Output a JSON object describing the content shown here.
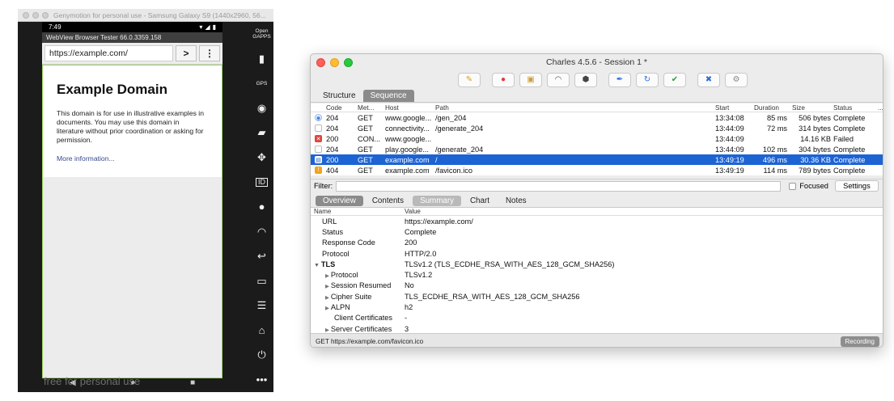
{
  "genymotion": {
    "title": "Genymotion for personal use - Samsung Galaxy S9 (1440x2960, 56...",
    "watermark": "free for personal use",
    "side_icons": [
      "Open GAPPS",
      "battery-icon",
      "GPS",
      "webcam-icon",
      "clapper-icon",
      "move-icon",
      "ID",
      "disk-icon",
      "rss-icon",
      "back-icon",
      "recent-apps-icon",
      "menu-icon",
      "home-icon",
      "power-icon",
      "more-icon"
    ],
    "side_labels": {
      "gapps": "Open GAPPS",
      "gps": "GPS",
      "id": "ID"
    }
  },
  "phone": {
    "time": "7:49",
    "app_title": "WebView Browser Tester 66.0.3359.158",
    "url": "https://example.com/",
    "go_button": ">",
    "menu_button": "⋮",
    "page": {
      "heading": "Example Domain",
      "paragraph": "This domain is for use in illustrative examples in documents. You may use this domain in literature without prior coordination or asking for permission.",
      "link": "More information..."
    }
  },
  "charles": {
    "title": "Charles 4.5.6 - Session 1 *",
    "top_tabs": [
      "Structure",
      "Sequence"
    ],
    "active_top_tab": "Sequence",
    "columns": [
      "Code",
      "Met...",
      "Host",
      "Path",
      "Start",
      "Duration",
      "Size",
      "Status"
    ],
    "more_column": "...",
    "rows": [
      {
        "code": "204",
        "method": "GET",
        "host": "www.google...",
        "path": "/gen_204",
        "start": "13:34:08",
        "duration": "85 ms",
        "size": "506 bytes",
        "status": "Complete",
        "icon": "blue-circle"
      },
      {
        "code": "204",
        "method": "GET",
        "host": "connectivity...",
        "path": "/generate_204",
        "start": "13:44:09",
        "duration": "72 ms",
        "size": "314 bytes",
        "status": "Complete",
        "icon": "doc"
      },
      {
        "code": "200",
        "method": "CON...",
        "host": "www.google...",
        "path": "",
        "start": "13:44:09",
        "duration": "",
        "size": "14.16 KB",
        "status": "Failed",
        "icon": "red-x"
      },
      {
        "code": "204",
        "method": "GET",
        "host": "play.google...",
        "path": "/generate_204",
        "start": "13:44:09",
        "duration": "102 ms",
        "size": "304 bytes",
        "status": "Complete",
        "icon": "doc"
      },
      {
        "code": "200",
        "method": "GET",
        "host": "example.com",
        "path": "/",
        "start": "13:49:19",
        "duration": "496 ms",
        "size": "30.36 KB",
        "status": "Complete",
        "icon": "doc-blue"
      },
      {
        "code": "404",
        "method": "GET",
        "host": "example.com",
        "path": "/favicon.ico",
        "start": "13:49:19",
        "duration": "114 ms",
        "size": "789 bytes",
        "status": "Complete",
        "icon": "orange-warning"
      }
    ],
    "selected_row": 4,
    "filter_label": "Filter:",
    "focused_label": "Focused",
    "settings_label": "Settings",
    "detail_tabs": [
      "Overview",
      "Contents",
      "Summary",
      "Chart",
      "Notes"
    ],
    "active_detail_tab": "Overview",
    "summary_columns": [
      "Name",
      "Value"
    ],
    "summary_rows": [
      {
        "name": "URL",
        "value": "https://example.com/",
        "level": 0
      },
      {
        "name": "Status",
        "value": "Complete",
        "level": 0
      },
      {
        "name": "Response Code",
        "value": "200",
        "level": 0
      },
      {
        "name": "Protocol",
        "value": "HTTP/2.0",
        "level": 0
      },
      {
        "name": "TLS",
        "value": "TLSv1.2 (TLS_ECDHE_RSA_WITH_AES_128_GCM_SHA256)",
        "level": "group"
      },
      {
        "name": "Protocol",
        "value": "TLSv1.2",
        "level": 1
      },
      {
        "name": "Session Resumed",
        "value": "No",
        "level": 1
      },
      {
        "name": "Cipher Suite",
        "value": "TLS_ECDHE_RSA_WITH_AES_128_GCM_SHA256",
        "level": 1
      },
      {
        "name": "ALPN",
        "value": "h2",
        "level": 1
      },
      {
        "name": "Client Certificates",
        "value": "-",
        "level": 2
      },
      {
        "name": "Server Certificates",
        "value": "3",
        "level": 1
      }
    ],
    "status_text": "GET https://example.com/favicon.ico",
    "recording_label": "Recording",
    "colors": {
      "selection": "#1c63d3",
      "accent_tab": "#8b8b8b"
    }
  }
}
